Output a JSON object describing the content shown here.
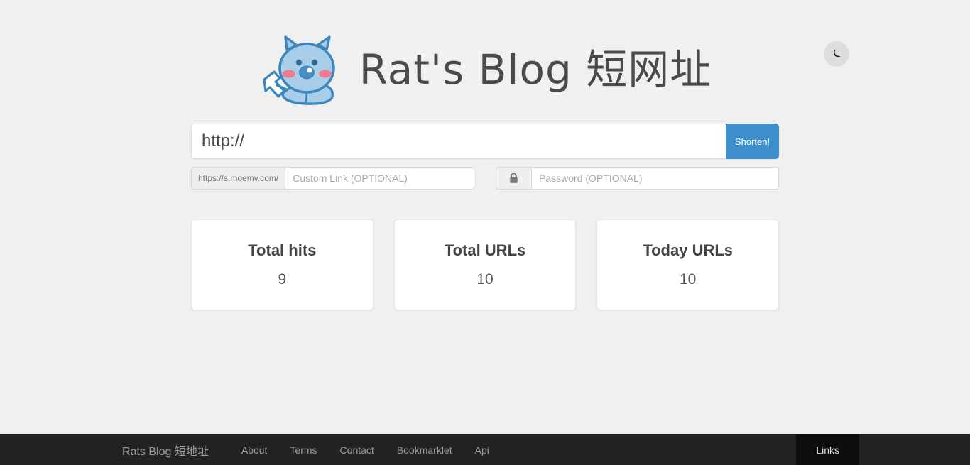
{
  "theme_toggle": {
    "name": "dark-mode-toggle",
    "icon": "moon-icon"
  },
  "header": {
    "brand_text": "Rat's Blog 短网址",
    "mascot_alt": "rat-mascot-logo"
  },
  "form": {
    "url_value": "http://",
    "url_placeholder": "http://",
    "shorten_label": "Shorten!",
    "custom_prefix": "https://s.moemv.com/",
    "custom_placeholder": "Custom Link (OPTIONAL)",
    "custom_value": "",
    "password_icon": "lock-icon",
    "password_placeholder": "Password (OPTIONAL)",
    "password_value": ""
  },
  "stats": [
    {
      "title": "Total hits",
      "value": "9"
    },
    {
      "title": "Total URLs",
      "value": "10"
    },
    {
      "title": "Today URLs",
      "value": "10"
    }
  ],
  "footer": {
    "brand": "Rats Blog 短地址",
    "links": [
      {
        "label": "About"
      },
      {
        "label": "Terms"
      },
      {
        "label": "Contact"
      },
      {
        "label": "Bookmarklet"
      },
      {
        "label": "Api"
      }
    ],
    "right_tab": "Links"
  },
  "colors": {
    "page_bg": "#f0f0f0",
    "accent_blue": "#3e8ecc",
    "footer_bg": "#222222",
    "footer_tab_bg": "#0d0d0d",
    "mascot_body": "#a8cde8",
    "mascot_outline": "#3d87bd",
    "mascot_cheek": "#f2798f",
    "brand_text": "#4a4a4a"
  }
}
